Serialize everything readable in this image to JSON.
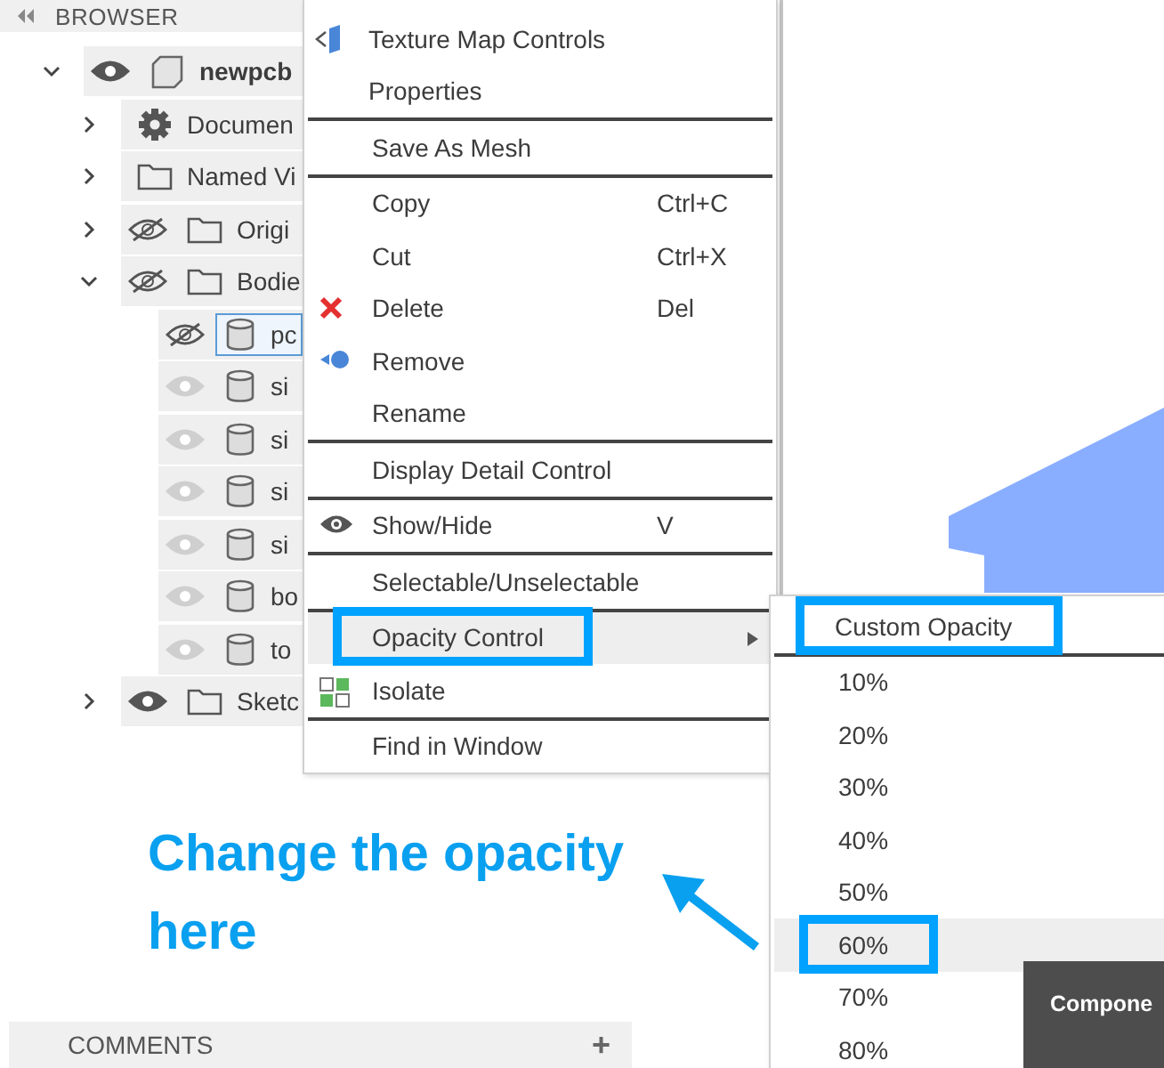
{
  "browser": {
    "title": "BROWSER",
    "tree": [
      {
        "label": "newpcb",
        "kind": "component",
        "hidden": false,
        "dimmed": false,
        "expanded": true,
        "bold": true,
        "selected": false,
        "children": [
          {
            "label": "Documen",
            "kind": "settings",
            "expanded": false,
            "selected": false
          },
          {
            "label": "Named Vi",
            "kind": "folder",
            "expanded": false,
            "selected": false
          },
          {
            "label": "Origi",
            "kind": "folder",
            "hidden": true,
            "dimmed": false,
            "expanded": false,
            "selected": false
          },
          {
            "label": "Bodie",
            "kind": "folder",
            "hidden": true,
            "dimmed": false,
            "expanded": true,
            "selected": false,
            "children": [
              {
                "label": "pc",
                "kind": "body",
                "hidden": true,
                "dimmed": false,
                "selected": true
              },
              {
                "label": "si",
                "kind": "body",
                "hidden": false,
                "dimmed": true,
                "selected": false
              },
              {
                "label": "si",
                "kind": "body",
                "hidden": false,
                "dimmed": true,
                "selected": false
              },
              {
                "label": "si",
                "kind": "body",
                "hidden": false,
                "dimmed": true,
                "selected": false
              },
              {
                "label": "si",
                "kind": "body",
                "hidden": false,
                "dimmed": true,
                "selected": false
              },
              {
                "label": "bo",
                "kind": "body",
                "hidden": false,
                "dimmed": true,
                "selected": false
              },
              {
                "label": "to",
                "kind": "body",
                "hidden": false,
                "dimmed": true,
                "selected": false
              }
            ]
          },
          {
            "label": "Sketc",
            "kind": "folder",
            "hidden": false,
            "dimmed": false,
            "expanded": false,
            "selected": false
          }
        ]
      }
    ]
  },
  "context_menu": {
    "groups": [
      [
        {
          "label": "Texture Map Controls",
          "highlighted": false,
          "outlined": false
        },
        {
          "label": "Properties",
          "highlighted": false,
          "outlined": false
        }
      ],
      [
        {
          "label": "Save As Mesh",
          "highlighted": false,
          "outlined": false
        }
      ],
      [
        {
          "label": "Copy",
          "shortcut": "Ctrl+C",
          "highlighted": false,
          "outlined": false
        },
        {
          "label": "Cut",
          "shortcut": "Ctrl+X",
          "highlighted": false,
          "outlined": false
        },
        {
          "label": "Delete",
          "shortcut": "Del",
          "highlighted": false,
          "outlined": false
        },
        {
          "label": "Remove",
          "highlighted": false,
          "outlined": false
        },
        {
          "label": "Rename",
          "highlighted": false,
          "outlined": false
        }
      ],
      [
        {
          "label": "Display Detail Control",
          "highlighted": false,
          "outlined": false
        }
      ],
      [
        {
          "label": "Show/Hide",
          "shortcut": "V",
          "highlighted": false,
          "outlined": false
        }
      ],
      [
        {
          "label": "Selectable/Unselectable",
          "highlighted": false,
          "outlined": false
        }
      ],
      [
        {
          "label": "Opacity Control",
          "submenu": true,
          "highlighted": true,
          "outlined": true
        },
        {
          "label": "Isolate",
          "highlighted": false,
          "outlined": false
        }
      ],
      [
        {
          "label": "Find in Window",
          "highlighted": false,
          "outlined": false
        }
      ]
    ]
  },
  "submenu": {
    "groups": [
      [
        {
          "label": "Custom Opacity",
          "highlighted": false,
          "outlined": true
        }
      ],
      [
        {
          "label": "10%",
          "highlighted": false,
          "outlined": false
        },
        {
          "label": "20%",
          "highlighted": false,
          "outlined": false
        },
        {
          "label": "30%",
          "highlighted": false,
          "outlined": false
        },
        {
          "label": "40%",
          "highlighted": false,
          "outlined": false
        },
        {
          "label": "50%",
          "highlighted": false,
          "outlined": false
        },
        {
          "label": "60%",
          "highlighted": true,
          "outlined": true
        },
        {
          "label": "70%",
          "highlighted": false,
          "outlined": false
        },
        {
          "label": "80%",
          "highlighted": false,
          "outlined": false
        }
      ]
    ]
  },
  "tooltip": {
    "title": "Compone"
  },
  "annotation": {
    "text": "Change the opacity here"
  },
  "comments": {
    "title": "COMMENTS",
    "add": "+"
  }
}
